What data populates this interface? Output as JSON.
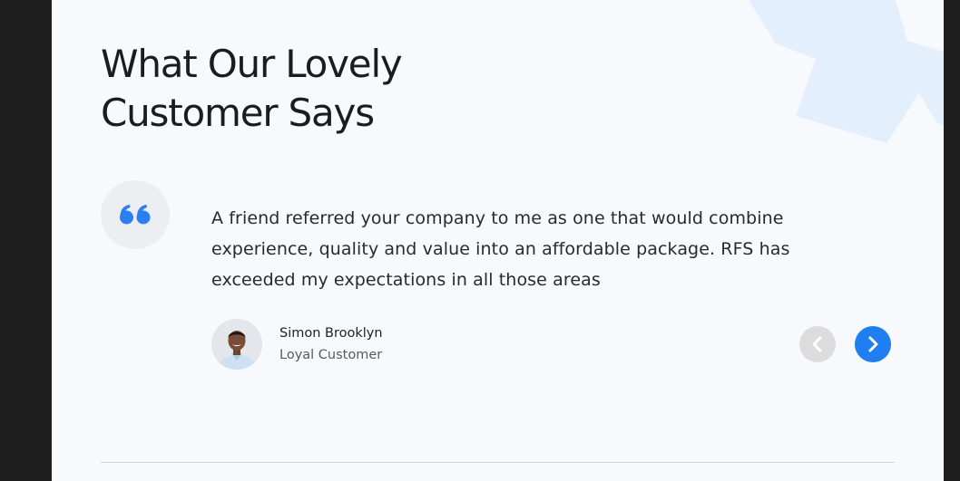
{
  "section": {
    "heading_line1": "What Our Lovely",
    "heading_line2": "Customer Says"
  },
  "testimonial": {
    "quote": "A friend referred your company to me as one that would combine experience, quality and value into an affordable package. RFS has exceeded my expectations in all those areas",
    "author_name": "Simon Brooklyn",
    "author_role": "Loyal Customer"
  },
  "icons": {
    "quote": "quote-icon",
    "prev": "chevron-left-icon",
    "next": "chevron-right-icon"
  },
  "colors": {
    "accent": "#1f7ff0",
    "nav_disabled": "#dcdcdc",
    "decoration": "#e4effd",
    "background": "#f7f9fd"
  }
}
